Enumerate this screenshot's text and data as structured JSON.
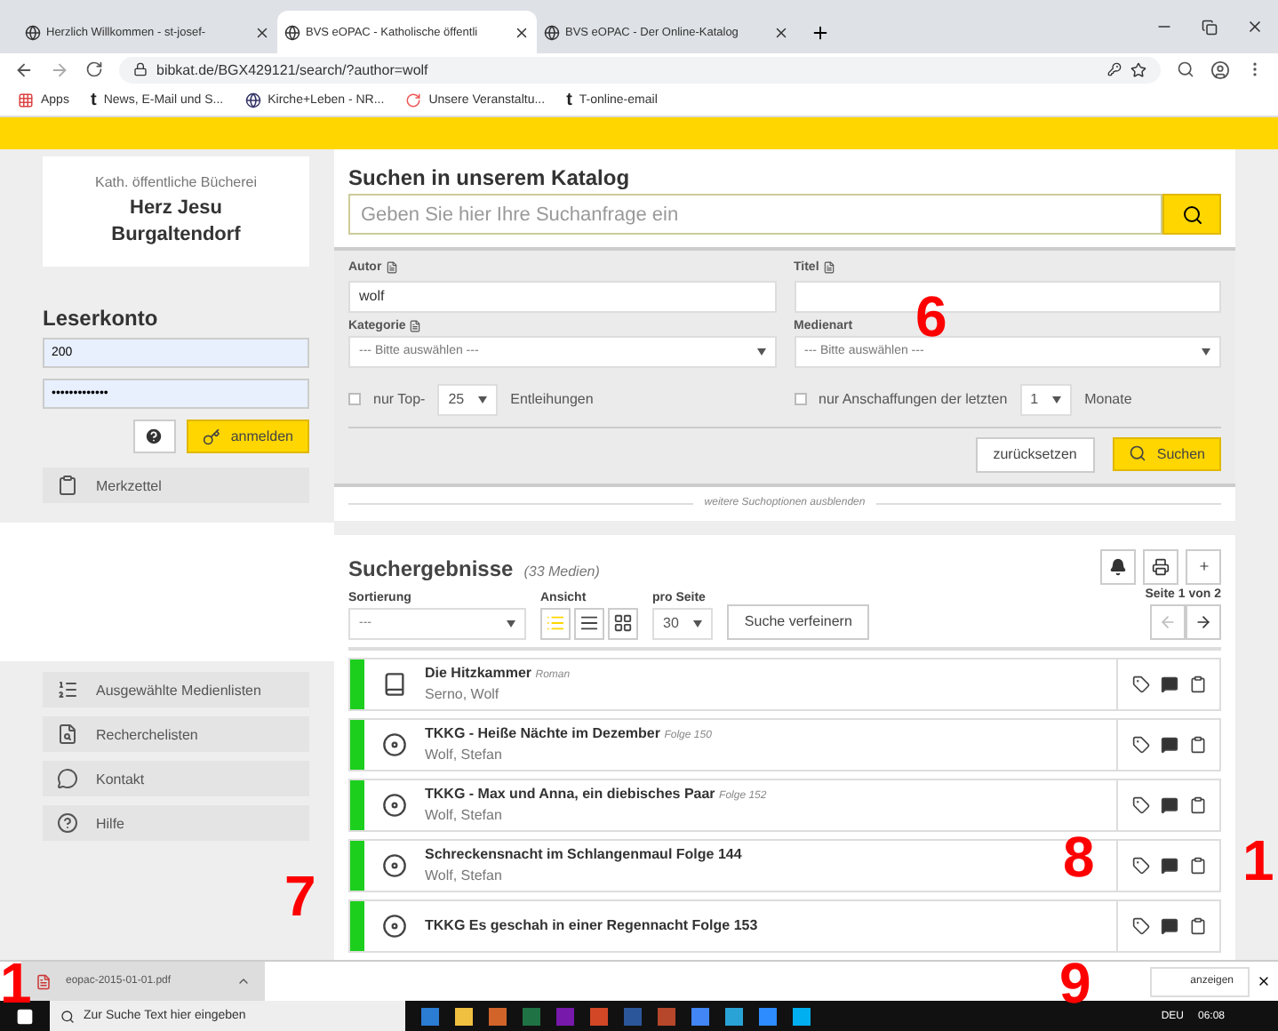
{
  "browser": {
    "tabs": [
      {
        "title": "Herzlich Willkommen - st-josef-",
        "selected": false
      },
      {
        "title": "BVS eOPAC - Katholische öffentli",
        "selected": true
      },
      {
        "title": "BVS eOPAC - Der Online-Katalog",
        "selected": false
      }
    ],
    "url": "bibkat.de/BGX429121/search/?author=wolf",
    "bookmarks": [
      {
        "label": "Apps",
        "kind": "apps"
      },
      {
        "label": "News, E-Mail und S...",
        "kind": "t"
      },
      {
        "label": "Kirche+Leben - NR...",
        "kind": "kirche"
      },
      {
        "label": "Unsere Veranstaltu...",
        "kind": "swirl"
      },
      {
        "label": "T-online-email",
        "kind": "t"
      }
    ]
  },
  "library": {
    "subtitle": "Kath. öffentliche Bücherei",
    "name": "Herz Jesu Burgaltendorf"
  },
  "login": {
    "title": "Leserkonto",
    "user": "200",
    "password": "•••••••••••••",
    "button": "anmelden"
  },
  "sidebar_top": [
    {
      "label": "Merkzettel",
      "kind": "clipboard"
    }
  ],
  "sidebar_bottom": [
    {
      "label": "Ausgewählte Medienlisten",
      "kind": "list"
    },
    {
      "label": "Recherchelisten",
      "kind": "search"
    },
    {
      "label": "Kontakt",
      "kind": "chat"
    },
    {
      "label": "Hilfe",
      "kind": "help"
    }
  ],
  "search": {
    "title": "Suchen in unserem Katalog",
    "placeholder": "Geben Sie hier Ihre Suchanfrage ein",
    "author_label": "Autor",
    "author_value": "wolf",
    "title_label": "Titel",
    "category_label": "Kategorie",
    "category_value": "--- Bitte auswählen ---",
    "media_label": "Medienart",
    "media_value": "--- Bitte auswählen ---",
    "top": {
      "checked": false,
      "label": "nur Top-",
      "value": "25",
      "suffix": "Entleihungen"
    },
    "recent": {
      "checked": false,
      "label": "nur Anschaffungen der letzten",
      "value": "1",
      "suffix": "Monate"
    },
    "reset": "zurücksetzen",
    "submit": "Suchen",
    "toggle": "weitere Suchoptionen ausblenden"
  },
  "results": {
    "title": "Suchergebnisse",
    "count": "(33 Medien)",
    "sort_label": "Sortierung",
    "sort_value": "---",
    "view_label": "Ansicht",
    "views": [
      {
        "kind": "list",
        "selected": true
      },
      {
        "kind": "compact",
        "selected": false
      },
      {
        "kind": "grid",
        "selected": false
      }
    ],
    "per_page_label": "pro Seite",
    "per_page": "30",
    "refine": "Suche verfeinern",
    "page": "Seite 1 von 2",
    "items": [
      {
        "kind": "book",
        "title": "Die Hitzkammer",
        "subtitle": "Roman",
        "author": "Serno, Wolf"
      },
      {
        "kind": "cd",
        "title": "TKKG - Heiße Nächte im Dezember",
        "subtitle": "Folge 150",
        "author": "Wolf, Stefan"
      },
      {
        "kind": "cd",
        "title": "TKKG - Max und Anna, ein diebisches Paar",
        "subtitle": "Folge 152",
        "author": "Wolf, Stefan"
      },
      {
        "kind": "cd",
        "title": "Schreckensnacht im Schlangenmaul Folge 144",
        "author": "Wolf, Stefan"
      },
      {
        "kind": "cd",
        "title": "TKKG Es geschah in einer Regennacht Folge 153"
      }
    ]
  },
  "download": {
    "file": "eopac-2015-01-01.pdf",
    "button": "anzeigen"
  },
  "taskbar": {
    "search": "Zur Suche Text hier eingeben",
    "language": "DEU",
    "time": "06:08"
  },
  "annotations": [
    {
      "label": "6"
    },
    {
      "label": "7"
    },
    {
      "label": "8"
    },
    {
      "label": "9"
    },
    {
      "label": "1"
    },
    {
      "label": "1"
    }
  ]
}
